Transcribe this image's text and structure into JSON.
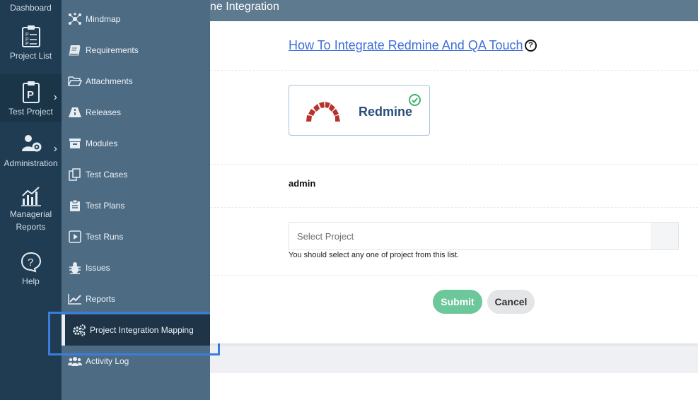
{
  "rail": {
    "dashboard": "Dashboard",
    "project_list": "Project List",
    "test_project": "Test Project",
    "administration": "Administration",
    "managerial_reports_line1": "Managerial",
    "managerial_reports_line2": "Reports",
    "help": "Help"
  },
  "submenu": {
    "items": [
      {
        "label": "Mindmap",
        "icon": "mindmap-icon"
      },
      {
        "label": "Requirements",
        "icon": "book-icon"
      },
      {
        "label": "Attachments",
        "icon": "folder-icon"
      },
      {
        "label": "Releases",
        "icon": "road-icon"
      },
      {
        "label": "Modules",
        "icon": "archive-icon"
      },
      {
        "label": "Test Cases",
        "icon": "copy-icon"
      },
      {
        "label": "Test Plans",
        "icon": "clipboard-icon"
      },
      {
        "label": "Test Runs",
        "icon": "play-square-icon"
      },
      {
        "label": "Issues",
        "icon": "bug-icon"
      },
      {
        "label": "Reports",
        "icon": "line-chart-icon"
      },
      {
        "label": "Project Integration Mapping",
        "icon": "gears-icon"
      },
      {
        "label": "Activity Log",
        "icon": "users-icon"
      }
    ],
    "active_index": 10
  },
  "header": {
    "title": "ne Integration"
  },
  "main": {
    "how_to_link": "How To Integrate Redmine And QA Touch",
    "help_glyph": "?",
    "integration_name": "Redmine",
    "username": "admin",
    "project_select_placeholder": "Select Project",
    "project_hint": "You should select any one of project from this list.",
    "submit_label": "Submit",
    "cancel_label": "Cancel"
  },
  "colors": {
    "rail_bg": "#1f3c53",
    "submenu_bg": "#4d6b83",
    "header_bg": "#5d7a8f",
    "submit_bg": "#6cc79a",
    "link": "#3f6fd8",
    "highlight": "#3b7ddd"
  }
}
